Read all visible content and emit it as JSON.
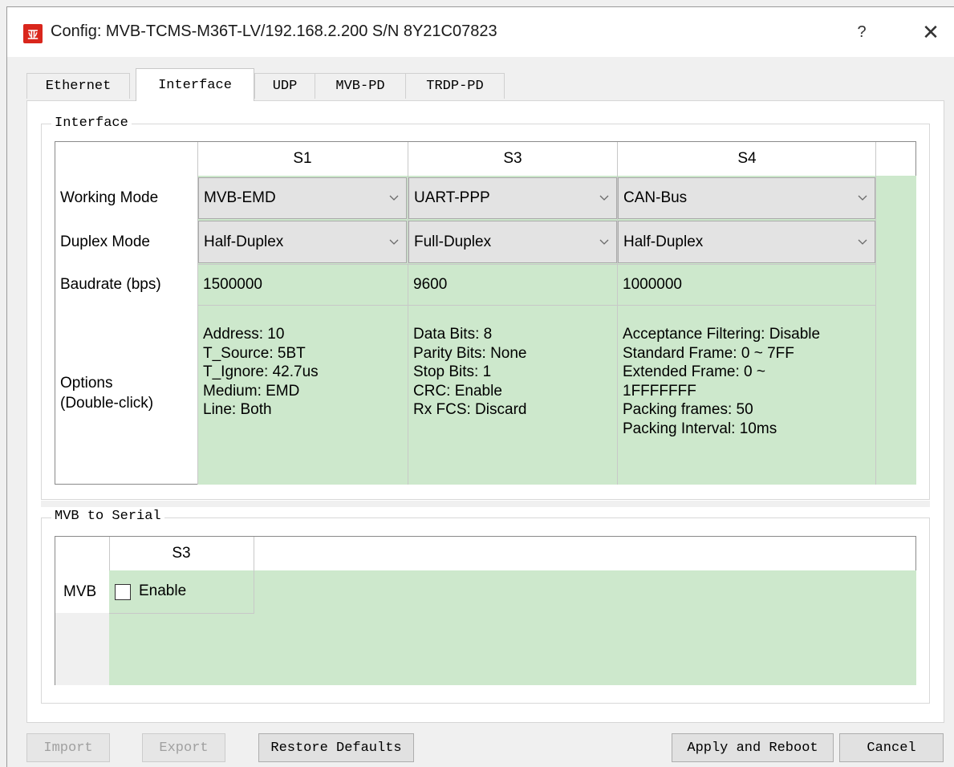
{
  "window": {
    "title": "Config: MVB-TCMS-M36T-LV/192.168.2.200  S/N 8Y21C07823",
    "app_icon_glyph": "亚",
    "help_glyph": "?",
    "close_glyph": "✕"
  },
  "tabs": [
    {
      "label": "Ethernet",
      "active": false
    },
    {
      "label": "Interface",
      "active": true
    },
    {
      "label": "UDP",
      "active": false
    },
    {
      "label": "MVB-PD",
      "active": false
    },
    {
      "label": "TRDP-PD",
      "active": false
    }
  ],
  "interface_group": {
    "title": "Interface",
    "columns": [
      "S1",
      "S3",
      "S4"
    ],
    "row_labels": {
      "working_mode": "Working Mode",
      "duplex_mode": "Duplex Mode",
      "baudrate": "Baudrate (bps)",
      "options_line1": "Options",
      "options_line2": "(Double-click)"
    },
    "working_mode": [
      "MVB-EMD",
      "UART-PPP",
      "CAN-Bus"
    ],
    "duplex_mode": [
      "Half-Duplex",
      "Full-Duplex",
      "Half-Duplex"
    ],
    "baudrate": [
      "1500000",
      "9600",
      "1000000"
    ],
    "options": [
      [
        "Address: 10",
        "T_Source: 5BT",
        "T_Ignore: 42.7us",
        "Medium: EMD",
        "Line: Both"
      ],
      [
        "Data Bits: 8",
        "Parity Bits: None",
        "Stop Bits: 1",
        "CRC: Enable",
        "Rx FCS: Discard"
      ],
      [
        "Acceptance Filtering: Disable",
        "Standard Frame: 0 ~ 7FF",
        "Extended Frame: 0 ~",
        "1FFFFFFF",
        "Packing frames: 50",
        "Packing Interval: 10ms"
      ]
    ]
  },
  "mvb_serial_group": {
    "title": "MVB to Serial",
    "column": "S3",
    "row_label": "MVB",
    "enable_label": "Enable",
    "enable_checked": false
  },
  "buttons": {
    "import": "Import",
    "export": "Export",
    "restore_defaults": "Restore Defaults",
    "apply_reboot": "Apply and Reboot",
    "cancel": "Cancel"
  },
  "colors": {
    "cell_green": "#cde8cc",
    "app_icon_red": "#d9261c"
  }
}
